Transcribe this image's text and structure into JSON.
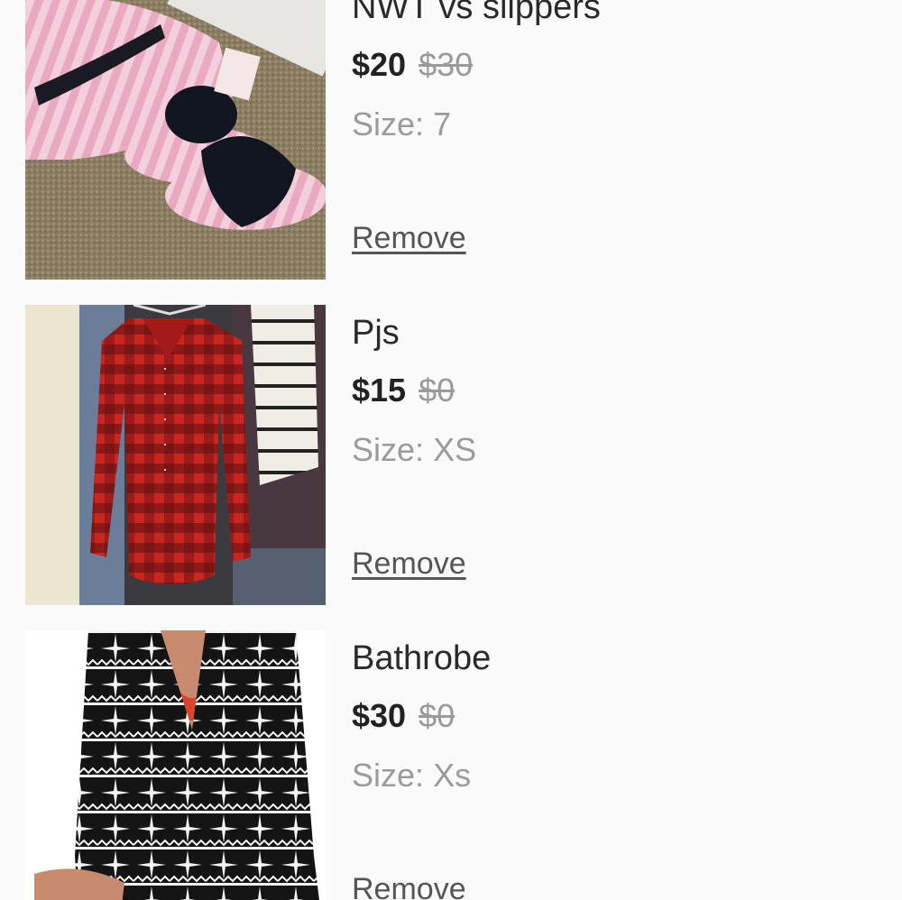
{
  "cart": {
    "items": [
      {
        "title": "NWT vs slippers",
        "price": "$20",
        "original_price": "$30",
        "size_label": "Size:",
        "size": "7",
        "remove_label": "Remove"
      },
      {
        "title": "Pjs",
        "price": "$15",
        "original_price": "$0",
        "size_label": "Size:",
        "size": "XS",
        "remove_label": "Remove"
      },
      {
        "title": "Bathrobe",
        "price": "$30",
        "original_price": "$0",
        "size_label": "Size:",
        "size": "Xs",
        "remove_label": "Remove"
      }
    ]
  }
}
